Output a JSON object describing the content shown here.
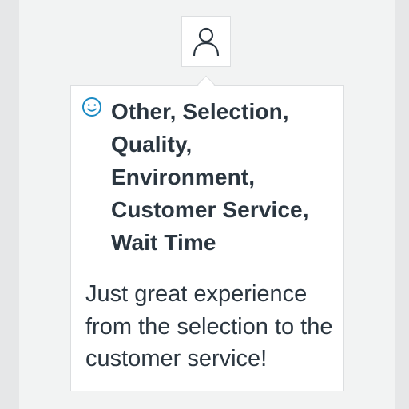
{
  "avatar": {
    "icon": "user-icon"
  },
  "review": {
    "sentiment_icon": "smiley-icon",
    "tags": "Other, Selection, Quality, Environment, Customer Service, Wait Time",
    "comment": "Just great experience from the selection to the customer service!"
  },
  "colors": {
    "accent": "#1c8bc4",
    "text": "#2b3640",
    "border": "#dcdee0",
    "background": "#e6e7e8"
  }
}
